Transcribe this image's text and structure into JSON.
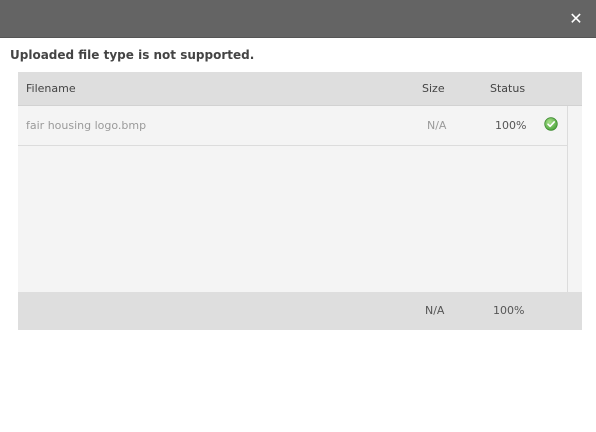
{
  "dialog": {
    "close_glyph": "✕"
  },
  "message": "Uploaded file type is not supported.",
  "table": {
    "columns": {
      "filename": "Filename",
      "size": "Size",
      "status": "Status"
    },
    "rows": [
      {
        "filename": "fair housing logo.bmp",
        "size": "N/A",
        "status": "100%",
        "status_icon": "check-circle-icon"
      }
    ],
    "footer": {
      "size": "N/A",
      "status": "100%"
    }
  },
  "colors": {
    "titlebar": "#646464",
    "header_bg": "#dedede",
    "body_bg": "#f4f4f4",
    "success": "#5cb85c"
  }
}
